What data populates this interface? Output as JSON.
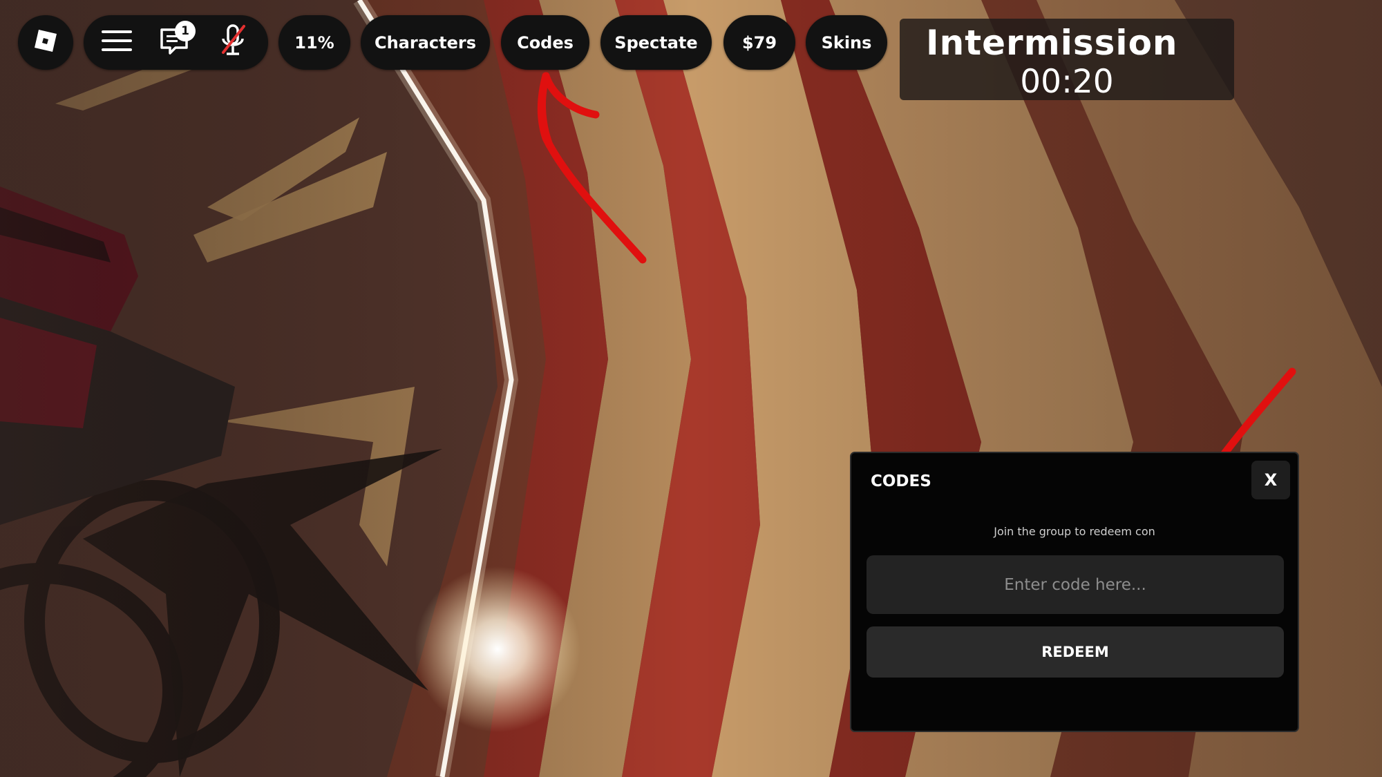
{
  "topbar": {
    "logo_icon": "roblox-logo-icon",
    "menu_icon": "hamburger-menu-icon",
    "chat_icon": "chat-bubble-icon",
    "chat_badge": "1",
    "mic_icon": "microphone-muted-icon",
    "percent": "11%",
    "characters_label": "Characters",
    "codes_label": "Codes",
    "spectate_label": "Spectate",
    "money_label": "$79",
    "skins_label": "Skins"
  },
  "intermission": {
    "title": "Intermission",
    "timer": "00:20"
  },
  "codes_panel": {
    "title": "CODES",
    "close_label": "X",
    "hint": "Join the group to redeem con",
    "input_placeholder": "Enter code here...",
    "input_value": "",
    "redeem_label": "REDEEM"
  },
  "annotations": {
    "arrow_color": "#e0100f",
    "arrow_top_icon": "red-arrow-pointing-to-codes-button",
    "arrow_bottom_icon": "red-arrow-pointing-to-code-input"
  },
  "colors": {
    "pill_bg": "#121212",
    "panel_bg": "#050505",
    "input_bg": "#232323",
    "button_bg": "#2a2a2a"
  }
}
